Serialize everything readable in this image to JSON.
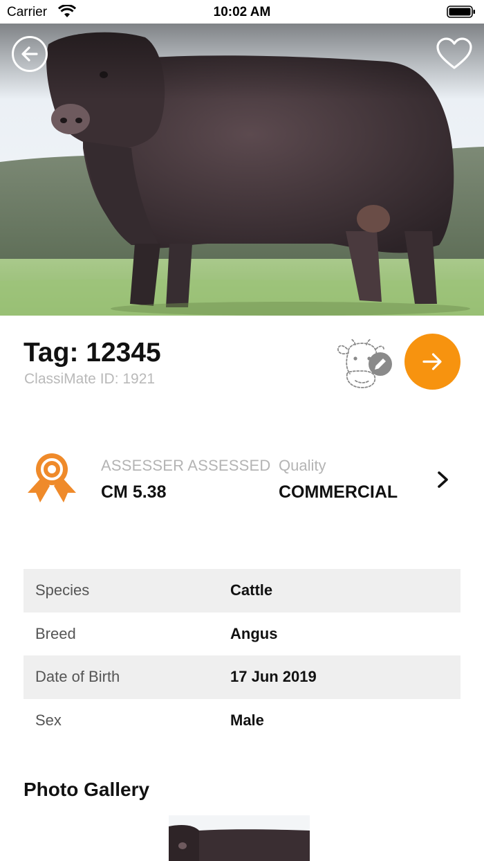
{
  "status_bar": {
    "carrier": "Carrier",
    "time": "10:02 AM"
  },
  "hero": {
    "image": "black-angus-bull-photo",
    "back_icon": "arrow-left-circle-icon",
    "favorite_icon": "heart-outline-icon"
  },
  "header": {
    "tag": "Tag: 12345",
    "classimate_id": "ClassiMate ID: 1921",
    "edit_icon": "cow-pencil-icon",
    "next_icon": "arrow-right-icon"
  },
  "assessment": {
    "label": "ASSESSER ASSESSED",
    "value": "CM 5.38",
    "quality_label": "Quality",
    "quality_value": "COMMERCIAL"
  },
  "details": [
    {
      "key": "Species",
      "value": "Cattle"
    },
    {
      "key": "Breed",
      "value": "Angus"
    },
    {
      "key": "Date of Birth",
      "value": "17 Jun 2019"
    },
    {
      "key": "Sex",
      "value": "Male"
    }
  ],
  "gallery": {
    "title": "Photo Gallery"
  },
  "colors": {
    "accent": "#f7930f",
    "award": "#ef8a2a",
    "row_shade": "#efefef",
    "muted_text": "#b4b4b4"
  }
}
